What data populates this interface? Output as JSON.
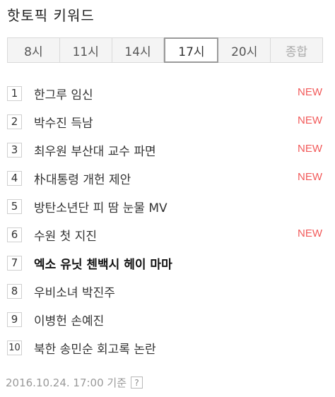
{
  "title": "핫토픽 키워드",
  "tabs": [
    {
      "label": "8시"
    },
    {
      "label": "11시"
    },
    {
      "label": "14시"
    },
    {
      "label": "17시"
    },
    {
      "label": "20시"
    },
    {
      "label": "종합"
    }
  ],
  "active_tab": "17시",
  "disabled_tab": "종합",
  "keywords": [
    {
      "rank": "1",
      "text": "한그루 임신",
      "badge": "NEW"
    },
    {
      "rank": "2",
      "text": "박수진 득남",
      "badge": "NEW"
    },
    {
      "rank": "3",
      "text": "최우원 부산대 교수 파면",
      "badge": "NEW"
    },
    {
      "rank": "4",
      "text": "朴대통령 개헌 제안",
      "badge": "NEW"
    },
    {
      "rank": "5",
      "text": "방탄소년단 피 땀 눈물 MV",
      "badge": ""
    },
    {
      "rank": "6",
      "text": "수원 첫 지진",
      "badge": "NEW"
    },
    {
      "rank": "7",
      "text": "엑소 유닛 첸백시 헤이 마마",
      "badge": "",
      "bold": true
    },
    {
      "rank": "8",
      "text": "우비소녀 박진주",
      "badge": ""
    },
    {
      "rank": "9",
      "text": "이병헌 손예진",
      "badge": ""
    },
    {
      "rank": "10",
      "text": "북한 송민순 회고록 논란",
      "badge": ""
    }
  ],
  "footer": {
    "timestamp": "2016.10.24. 17:00 기준",
    "help": "?"
  },
  "colors": {
    "new_badge": "#f25a5a",
    "active_tab_border": "#9a9a9a"
  }
}
